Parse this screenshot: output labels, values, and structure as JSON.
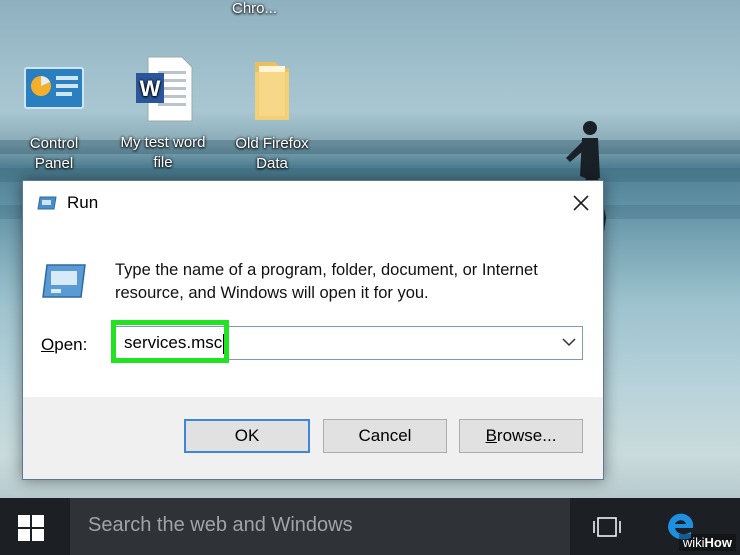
{
  "desktop": {
    "top_label": "Chro...",
    "icons": [
      {
        "label": "Control Panel",
        "icon": "control-panel-icon"
      },
      {
        "label": "My test word file",
        "icon": "word-document-icon"
      },
      {
        "label": "Old Firefox Data",
        "icon": "folder-icon"
      }
    ]
  },
  "dialog": {
    "title": "Run",
    "description": "Type the name of a program, folder, document, or Internet resource, and Windows will open it for you.",
    "open_label_first": "O",
    "open_label_rest": "pen:",
    "open_value": "services.msc",
    "buttons": {
      "ok": "OK",
      "cancel": "Cancel",
      "browse_first": "B",
      "browse_rest": "rowse..."
    },
    "highlight_color": "#22e322"
  },
  "taskbar": {
    "search_placeholder": "Search the web and Windows"
  },
  "watermark": {
    "part1": "wiki",
    "part2": "How"
  }
}
